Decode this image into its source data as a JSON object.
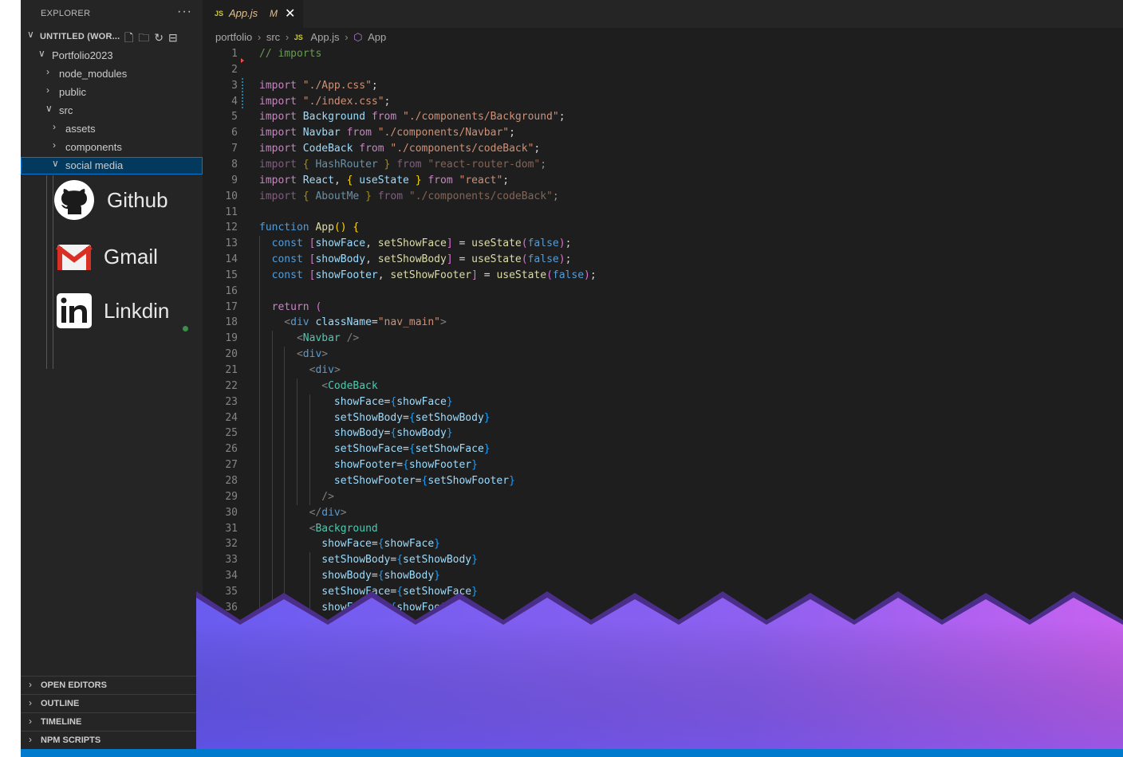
{
  "explorer": {
    "title": "EXPLORER",
    "more_icon": "ellipsis-icon",
    "workspace_label": "UNTITLED (WOR...",
    "tree": [
      {
        "label": "Portfolio2023",
        "expanded": true
      },
      {
        "label": "node_modules",
        "expanded": false
      },
      {
        "label": "public",
        "expanded": false
      },
      {
        "label": "src",
        "expanded": true
      },
      {
        "label": "assets",
        "expanded": false
      },
      {
        "label": "components",
        "expanded": false
      },
      {
        "label": "social media",
        "expanded": true,
        "selected": true
      }
    ],
    "social": [
      {
        "icon": "github-icon",
        "label": "Github"
      },
      {
        "icon": "gmail-icon",
        "label": "Gmail"
      },
      {
        "icon": "linkedin-icon",
        "label": "Linkdin"
      }
    ],
    "panels": [
      "OPEN EDITORS",
      "OUTLINE",
      "TIMELINE",
      "NPM SCRIPTS"
    ]
  },
  "tab": {
    "badge": "JS",
    "name": "App.js",
    "status": "M"
  },
  "breadcrumb": {
    "parts": [
      "portfolio",
      "src"
    ],
    "file_badge": "JS",
    "file": "App.js",
    "symbol": "App"
  },
  "code_lines": [
    [
      [
        "// imports",
        "c"
      ]
    ],
    [],
    [
      [
        "import ",
        "ck"
      ],
      [
        "\"./App.css\"",
        "s"
      ],
      [
        ";",
        "p"
      ]
    ],
    [
      [
        "import ",
        "ck"
      ],
      [
        "\"./index.css\"",
        "s"
      ],
      [
        ";",
        "p"
      ]
    ],
    [
      [
        "import ",
        "ck"
      ],
      [
        "Background ",
        "v"
      ],
      [
        "from ",
        "ck"
      ],
      [
        "\"./components/Background\"",
        "s"
      ],
      [
        ";",
        "p"
      ]
    ],
    [
      [
        "import ",
        "ck"
      ],
      [
        "Navbar ",
        "v"
      ],
      [
        "from ",
        "ck"
      ],
      [
        "\"./components/Navbar\"",
        "s"
      ],
      [
        ";",
        "p"
      ]
    ],
    [
      [
        "import ",
        "ck"
      ],
      [
        "CodeBack ",
        "v"
      ],
      [
        "from ",
        "ck"
      ],
      [
        "\"./components/codeBack\"",
        "s"
      ],
      [
        ";",
        "p"
      ]
    ],
    [
      [
        "import ",
        "ck faded"
      ],
      [
        "{ ",
        "b1 faded"
      ],
      [
        "HashRouter ",
        "v faded"
      ],
      [
        "} ",
        "b1 faded"
      ],
      [
        "from ",
        "ck faded"
      ],
      [
        "\"react-router-dom\"",
        "s faded"
      ],
      [
        ";",
        "p faded"
      ]
    ],
    [
      [
        "import ",
        "ck"
      ],
      [
        "React",
        "v"
      ],
      [
        ", ",
        "p"
      ],
      [
        "{ ",
        "b1"
      ],
      [
        "useState ",
        "v"
      ],
      [
        "} ",
        "b1"
      ],
      [
        "from ",
        "ck"
      ],
      [
        "\"react\"",
        "s"
      ],
      [
        ";",
        "p"
      ]
    ],
    [
      [
        "import ",
        "ck faded"
      ],
      [
        "{ ",
        "b1 faded"
      ],
      [
        "AboutMe ",
        "v faded"
      ],
      [
        "} ",
        "b1 faded"
      ],
      [
        "from ",
        "ck faded"
      ],
      [
        "\"./components/codeBack\"",
        "s faded"
      ],
      [
        ";",
        "p faded"
      ]
    ],
    [],
    [
      [
        "function ",
        "k"
      ],
      [
        "App",
        "f"
      ],
      [
        "() ",
        "b1"
      ],
      [
        "{",
        "b1"
      ]
    ],
    [
      [
        "  const ",
        "k"
      ],
      [
        "[",
        "b2"
      ],
      [
        "showFace",
        "v"
      ],
      [
        ", ",
        "p"
      ],
      [
        "setShowFace",
        "f"
      ],
      [
        "]",
        "b2"
      ],
      [
        " = ",
        "p"
      ],
      [
        "useState",
        "f"
      ],
      [
        "(",
        "b2"
      ],
      [
        "false",
        "k"
      ],
      [
        ")",
        "b2"
      ],
      [
        ";",
        "p"
      ]
    ],
    [
      [
        "  const ",
        "k"
      ],
      [
        "[",
        "b2"
      ],
      [
        "showBody",
        "v"
      ],
      [
        ", ",
        "p"
      ],
      [
        "setShowBody",
        "f"
      ],
      [
        "]",
        "b2"
      ],
      [
        " = ",
        "p"
      ],
      [
        "useState",
        "f"
      ],
      [
        "(",
        "b2"
      ],
      [
        "false",
        "k"
      ],
      [
        ")",
        "b2"
      ],
      [
        ";",
        "p"
      ]
    ],
    [
      [
        "  const ",
        "k"
      ],
      [
        "[",
        "b2"
      ],
      [
        "showFooter",
        "v"
      ],
      [
        ", ",
        "p"
      ],
      [
        "setShowFooter",
        "f"
      ],
      [
        "]",
        "b2"
      ],
      [
        " = ",
        "p"
      ],
      [
        "useState",
        "f"
      ],
      [
        "(",
        "b2"
      ],
      [
        "false",
        "k"
      ],
      [
        ")",
        "b2"
      ],
      [
        ";",
        "p"
      ]
    ],
    [],
    [
      [
        "  return ",
        "ck"
      ],
      [
        "(",
        "b2"
      ]
    ],
    [
      [
        "    <",
        "g"
      ],
      [
        "div ",
        "k"
      ],
      [
        "className",
        "v"
      ],
      [
        "=",
        "p"
      ],
      [
        "\"nav_main\"",
        "s"
      ],
      [
        ">",
        "g"
      ]
    ],
    [
      [
        "      <",
        "g"
      ],
      [
        "Navbar ",
        "t"
      ],
      [
        "/>",
        "g"
      ]
    ],
    [
      [
        "      <",
        "g"
      ],
      [
        "div",
        "k"
      ],
      [
        ">",
        "g"
      ]
    ],
    [
      [
        "        <",
        "g"
      ],
      [
        "div",
        "k"
      ],
      [
        ">",
        "g"
      ]
    ],
    [
      [
        "          <",
        "g"
      ],
      [
        "CodeBack",
        "t"
      ]
    ],
    [
      [
        "            showFace",
        "v"
      ],
      [
        "=",
        "p"
      ],
      [
        "{",
        "b3"
      ],
      [
        "showFace",
        "v"
      ],
      [
        "}",
        "b3"
      ]
    ],
    [
      [
        "            setShowBody",
        "v"
      ],
      [
        "=",
        "p"
      ],
      [
        "{",
        "b3"
      ],
      [
        "setShowBody",
        "v"
      ],
      [
        "}",
        "b3"
      ]
    ],
    [
      [
        "            showBody",
        "v"
      ],
      [
        "=",
        "p"
      ],
      [
        "{",
        "b3"
      ],
      [
        "showBody",
        "v"
      ],
      [
        "}",
        "b3"
      ]
    ],
    [
      [
        "            setShowFace",
        "v"
      ],
      [
        "=",
        "p"
      ],
      [
        "{",
        "b3"
      ],
      [
        "setShowFace",
        "v"
      ],
      [
        "}",
        "b3"
      ]
    ],
    [
      [
        "            showFooter",
        "v"
      ],
      [
        "=",
        "p"
      ],
      [
        "{",
        "b3"
      ],
      [
        "showFooter",
        "v"
      ],
      [
        "}",
        "b3"
      ]
    ],
    [
      [
        "            setShowFooter",
        "v"
      ],
      [
        "=",
        "p"
      ],
      [
        "{",
        "b3"
      ],
      [
        "setShowFooter",
        "v"
      ],
      [
        "}",
        "b3"
      ]
    ],
    [
      [
        "          />",
        "g"
      ]
    ],
    [
      [
        "        </",
        "g"
      ],
      [
        "div",
        "k"
      ],
      [
        ">",
        "g"
      ]
    ],
    [
      [
        "        <",
        "g"
      ],
      [
        "Background",
        "t"
      ]
    ],
    [
      [
        "          showFace",
        "v"
      ],
      [
        "=",
        "p"
      ],
      [
        "{",
        "b3"
      ],
      [
        "showFace",
        "v"
      ],
      [
        "}",
        "b3"
      ]
    ],
    [
      [
        "          setShowBody",
        "v"
      ],
      [
        "=",
        "p"
      ],
      [
        "{",
        "b3"
      ],
      [
        "setShowBody",
        "v"
      ],
      [
        "}",
        "b3"
      ]
    ],
    [
      [
        "          showBody",
        "v"
      ],
      [
        "=",
        "p"
      ],
      [
        "{",
        "b3"
      ],
      [
        "showBody",
        "v"
      ],
      [
        "}",
        "b3"
      ]
    ],
    [
      [
        "          setShowFace",
        "v"
      ],
      [
        "=",
        "p"
      ],
      [
        "{",
        "b3"
      ],
      [
        "setShowFace",
        "v"
      ],
      [
        "}",
        "b3"
      ]
    ],
    [
      [
        "          showFooter",
        "v"
      ],
      [
        "=",
        "p"
      ],
      [
        "{",
        "b3"
      ],
      [
        "showFooter",
        "v"
      ],
      [
        "}",
        "b3"
      ]
    ]
  ],
  "colors": {
    "accent": "#007acc",
    "selection": "#04395e",
    "wave_left": "#6a5cf0",
    "wave_right": "#c862f0"
  }
}
